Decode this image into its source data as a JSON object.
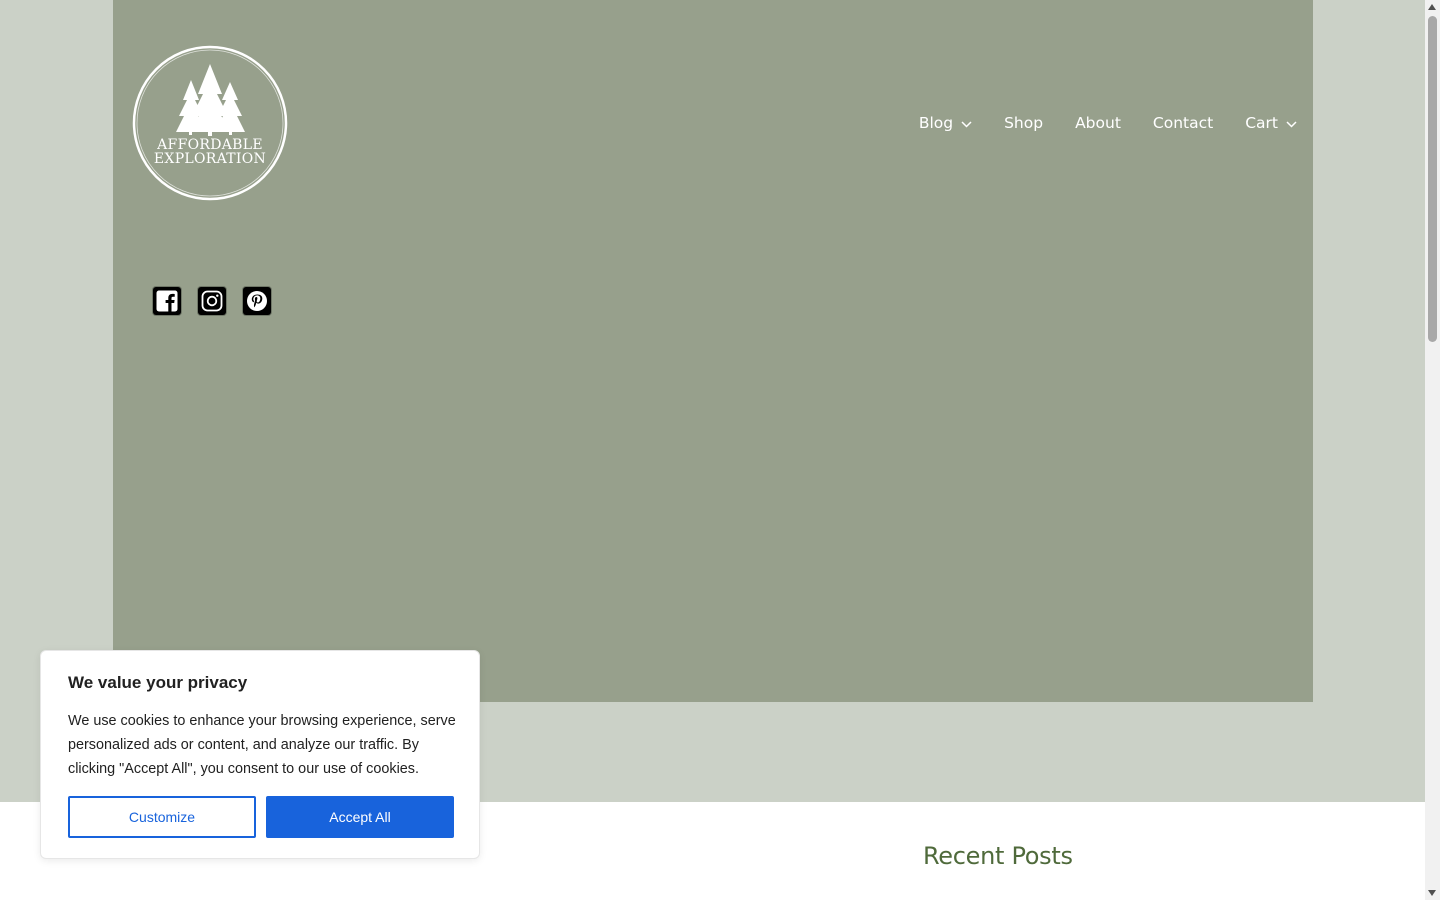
{
  "brand": {
    "logo_line1": "AFFORDABLE",
    "logo_line2": "EXPLORATION",
    "logo_icon": "pine-trees-logo"
  },
  "nav": {
    "items": [
      {
        "label": "Blog",
        "has_dropdown": true
      },
      {
        "label": "Shop",
        "has_dropdown": false
      },
      {
        "label": "About",
        "has_dropdown": false
      },
      {
        "label": "Contact",
        "has_dropdown": false
      },
      {
        "label": "Cart",
        "has_dropdown": true
      }
    ]
  },
  "social": [
    {
      "icon": "facebook-icon"
    },
    {
      "icon": "instagram-icon"
    },
    {
      "icon": "pinterest-icon"
    }
  ],
  "sidebar": {
    "recent_posts_heading": "Recent Posts"
  },
  "cookie_banner": {
    "title": "We value your privacy",
    "text": "We use cookies to enhance your browsing experience, serve personalized ads or content, and analyze our traffic. By clicking \"Accept All\", you consent to our use of cookies.",
    "customize_label": "Customize",
    "accept_label": "Accept All"
  },
  "colors": {
    "hero_bg": "#97a08c",
    "page_bg": "#cbd1c7",
    "accent_blue": "#1863dc",
    "heading_green": "#4f6a3b"
  }
}
